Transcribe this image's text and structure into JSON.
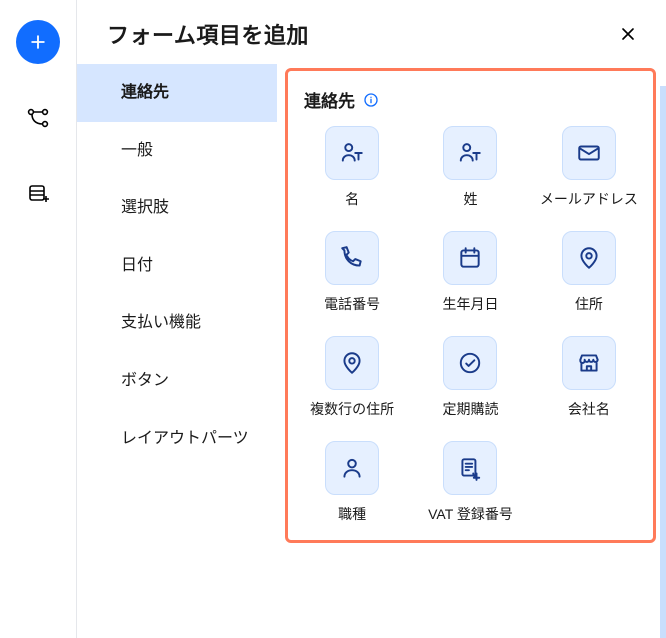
{
  "rail": {
    "add_label": "追加",
    "flow_label": "フロー",
    "table_label": "テーブル"
  },
  "panel": {
    "title": "フォーム項目を追加",
    "close": "閉じる"
  },
  "categories": [
    {
      "key": "contact",
      "label": "連絡先",
      "active": true
    },
    {
      "key": "general",
      "label": "一般",
      "active": false
    },
    {
      "key": "choice",
      "label": "選択肢",
      "active": false
    },
    {
      "key": "date",
      "label": "日付",
      "active": false
    },
    {
      "key": "payment",
      "label": "支払い機能",
      "active": false
    },
    {
      "key": "button",
      "label": "ボタン",
      "active": false
    },
    {
      "key": "layout",
      "label": "レイアウトパーツ",
      "active": false
    }
  ],
  "section": {
    "title": "連絡先"
  },
  "fields": [
    {
      "key": "first_name",
      "label": "名",
      "icon": "person-t"
    },
    {
      "key": "last_name",
      "label": "姓",
      "icon": "person-t"
    },
    {
      "key": "email",
      "label": "メールアドレス",
      "icon": "mail"
    },
    {
      "key": "phone",
      "label": "電話番号",
      "icon": "phone"
    },
    {
      "key": "birthday",
      "label": "生年月日",
      "icon": "calendar"
    },
    {
      "key": "address",
      "label": "住所",
      "icon": "pin"
    },
    {
      "key": "multi_address",
      "label": "複数行の住所",
      "icon": "pin"
    },
    {
      "key": "subscription",
      "label": "定期購読",
      "icon": "check-circle"
    },
    {
      "key": "company",
      "label": "会社名",
      "icon": "storefront"
    },
    {
      "key": "job",
      "label": "職種",
      "icon": "person"
    },
    {
      "key": "vat",
      "label": "VAT 登録番号",
      "icon": "receipt"
    }
  ]
}
